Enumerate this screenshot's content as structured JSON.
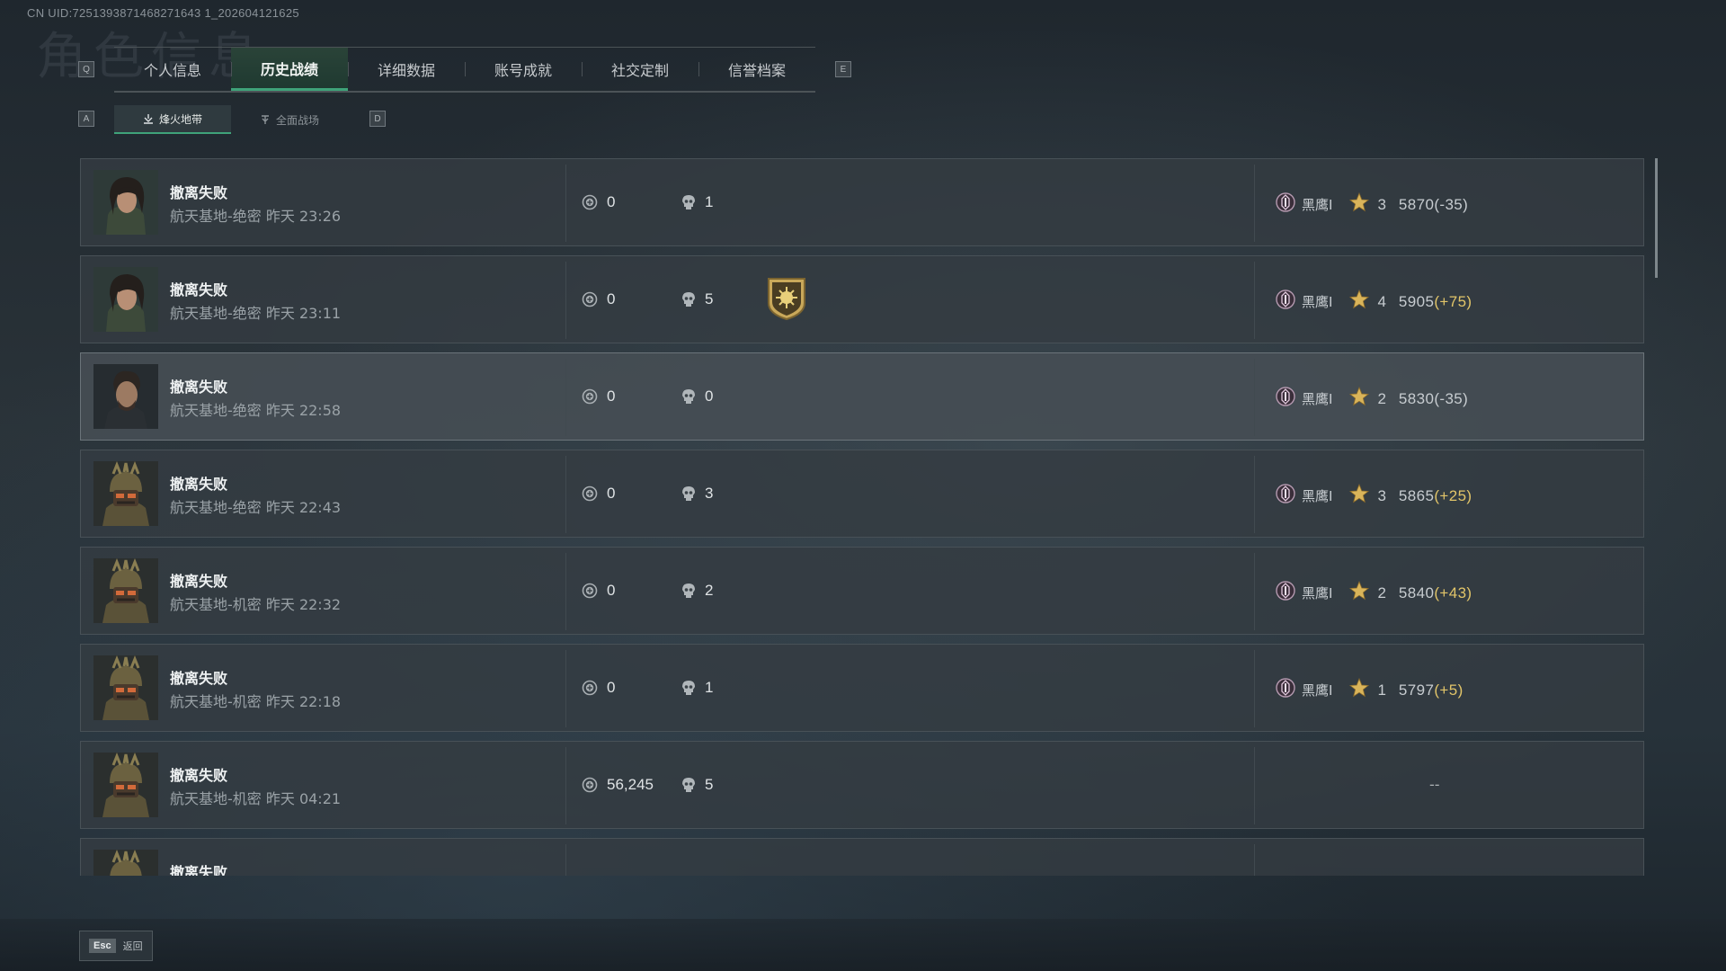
{
  "header": {
    "uid": "CN UID:7251393871468271643 1_202604121625",
    "ghost_title": "角色信息"
  },
  "tabs": {
    "left_key": "Q",
    "right_key": "E",
    "items": [
      {
        "label": "个人信息"
      },
      {
        "label": "历史战绩",
        "active": true
      },
      {
        "label": "详细数据"
      },
      {
        "label": "账号成就"
      },
      {
        "label": "社交定制"
      },
      {
        "label": "信誉档案"
      }
    ]
  },
  "subtabs": {
    "left_key": "A",
    "right_key": "D",
    "items": [
      {
        "label": "烽火地带",
        "active": true
      },
      {
        "label": "全面战场"
      }
    ]
  },
  "matches": [
    {
      "status": "撤离失败",
      "detail": "航天基地-绝密 昨天 23:26",
      "value": "0",
      "kills": "1",
      "rank_name": "黑鹰Ⅰ",
      "stars": "3",
      "score": "5870",
      "delta": "(-35)",
      "delta_positive": false,
      "avatar": "woman"
    },
    {
      "status": "撤离失败",
      "detail": "航天基地-绝密 昨天 23:11",
      "value": "0",
      "kills": "5",
      "rank_name": "黑鹰Ⅰ",
      "stars": "4",
      "score": "5905",
      "delta": "(+75)",
      "delta_positive": true,
      "avatar": "woman",
      "badge": true
    },
    {
      "status": "撤离失败",
      "detail": "航天基地-绝密 昨天 22:58",
      "value": "0",
      "kills": "0",
      "rank_name": "黑鹰Ⅰ",
      "stars": "2",
      "score": "5830",
      "delta": "(-35)",
      "delta_positive": false,
      "avatar": "man"
    },
    {
      "status": "撤离失败",
      "detail": "航天基地-绝密 昨天 22:43",
      "value": "0",
      "kills": "3",
      "rank_name": "黑鹰Ⅰ",
      "stars": "3",
      "score": "5865",
      "delta": "(+25)",
      "delta_positive": true,
      "avatar": "helmet"
    },
    {
      "status": "撤离失败",
      "detail": "航天基地-机密 昨天 22:32",
      "value": "0",
      "kills": "2",
      "rank_name": "黑鹰Ⅰ",
      "stars": "2",
      "score": "5840",
      "delta": "(+43)",
      "delta_positive": true,
      "avatar": "helmet"
    },
    {
      "status": "撤离失败",
      "detail": "航天基地-机密 昨天 22:18",
      "value": "0",
      "kills": "1",
      "rank_name": "黑鹰Ⅰ",
      "stars": "1",
      "score": "5797",
      "delta": "(+5)",
      "delta_positive": true,
      "avatar": "helmet"
    },
    {
      "status": "撤离失败",
      "detail": "航天基地-机密 昨天 04:21",
      "value": "56,245",
      "kills": "5",
      "no_rank": "--",
      "avatar": "helmet"
    },
    {
      "status": "撤离失败",
      "detail": "",
      "value": "",
      "kills": "",
      "avatar": "helmet"
    }
  ],
  "footer": {
    "esc_key": "Esc",
    "back_label": "返回"
  },
  "colors": {
    "accent": "#3fa37a",
    "positive_delta": "#e2c569",
    "star": "#d9b45a"
  },
  "icons": {
    "value": "coin-icon",
    "kills": "skull-icon",
    "rank": "rank-emblem-icon",
    "star": "star-icon",
    "badge": "mvp-badge-icon"
  }
}
